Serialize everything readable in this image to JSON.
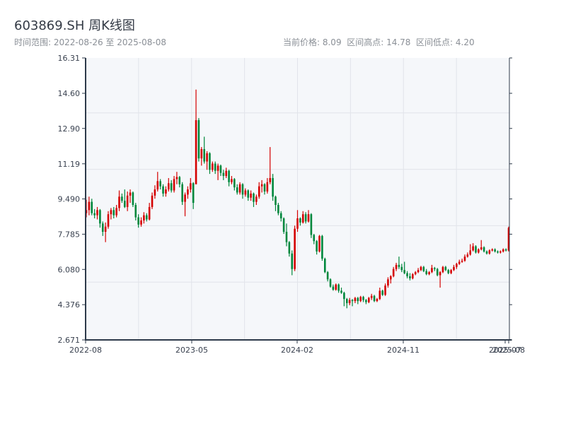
{
  "header": {
    "title": "603869.SH 周K线图",
    "range_text": "时间范围: 2022-08-26 至 2025-08-08",
    "stats_text": "当前价格: 8.09  区间高点: 14.78  区间低点: 4.20"
  },
  "chart_data": {
    "type": "candlestick",
    "title": "603869.SH 周K线图",
    "start_date": "2022-08-26",
    "end_date": "2025-08-08",
    "frequency": "weekly",
    "current_price": 8.09,
    "range_high": 14.78,
    "range_low": 4.2,
    "ylim": [
      2.671,
      16.31
    ],
    "y_ticks": [
      "16.31",
      "14.60",
      "12.90",
      "11.19",
      "9.490",
      "7.785",
      "6.080",
      "4.376",
      "2.671"
    ],
    "x_ticks": [
      "2022-08",
      "2023-05",
      "2024-02",
      "2024-11",
      "2025-07",
      "2025-08"
    ],
    "grid": true,
    "colors": {
      "up": "#d40000",
      "down": "#00873c",
      "plot_bg": "#f5f7fa",
      "grid": "#e1e4ea",
      "axis": "#2d3a4a"
    },
    "ohlc_fields": [
      "open",
      "high",
      "low",
      "close"
    ],
    "ohlc": [
      [
        8.8,
        9.45,
        8.6,
        8.95
      ],
      [
        8.95,
        9.6,
        8.7,
        9.35
      ],
      [
        9.35,
        9.5,
        8.7,
        8.8
      ],
      [
        8.8,
        9.0,
        8.55,
        8.7
      ],
      [
        8.7,
        9.1,
        8.5,
        8.95
      ],
      [
        8.95,
        9.0,
        8.1,
        8.3
      ],
      [
        8.3,
        8.4,
        7.7,
        7.9
      ],
      [
        7.9,
        8.35,
        7.4,
        8.15
      ],
      [
        8.15,
        8.9,
        8.05,
        8.75
      ],
      [
        8.75,
        9.05,
        8.5,
        8.95
      ],
      [
        8.95,
        9.1,
        8.55,
        8.7
      ],
      [
        8.7,
        9.2,
        8.6,
        9.05
      ],
      [
        9.05,
        9.9,
        8.9,
        9.6
      ],
      [
        9.6,
        9.75,
        9.3,
        9.4
      ],
      [
        9.4,
        9.95,
        9.05,
        9.1
      ],
      [
        9.1,
        9.85,
        8.9,
        9.65
      ],
      [
        9.65,
        9.95,
        9.3,
        9.8
      ],
      [
        9.8,
        9.85,
        9.1,
        9.2
      ],
      [
        9.2,
        9.3,
        8.45,
        8.6
      ],
      [
        8.6,
        8.75,
        8.1,
        8.25
      ],
      [
        8.25,
        8.6,
        8.15,
        8.45
      ],
      [
        8.45,
        8.85,
        8.3,
        8.7
      ],
      [
        8.7,
        8.8,
        8.4,
        8.5
      ],
      [
        8.5,
        9.3,
        8.45,
        9.1
      ],
      [
        9.1,
        9.8,
        9.0,
        9.65
      ],
      [
        9.65,
        10.15,
        9.5,
        9.95
      ],
      [
        9.95,
        10.8,
        9.85,
        10.35
      ],
      [
        10.35,
        10.45,
        9.95,
        10.1
      ],
      [
        10.1,
        10.2,
        9.6,
        9.75
      ],
      [
        9.75,
        10.1,
        9.6,
        9.95
      ],
      [
        9.95,
        10.5,
        9.85,
        10.25
      ],
      [
        10.25,
        10.4,
        9.8,
        9.9
      ],
      [
        9.9,
        10.6,
        9.8,
        10.45
      ],
      [
        10.45,
        10.8,
        10.2,
        10.55
      ],
      [
        10.55,
        10.6,
        10.05,
        10.2
      ],
      [
        10.2,
        10.3,
        9.2,
        9.35
      ],
      [
        9.35,
        9.8,
        8.65,
        9.7
      ],
      [
        9.7,
        10.1,
        9.5,
        9.95
      ],
      [
        9.95,
        10.5,
        9.8,
        10.25
      ],
      [
        10.25,
        10.3,
        9.0,
        9.3
      ],
      [
        10.2,
        14.78,
        10.2,
        13.3
      ],
      [
        13.3,
        13.4,
        11.3,
        11.45
      ],
      [
        11.45,
        12.0,
        11.1,
        11.9
      ],
      [
        11.9,
        12.5,
        11.2,
        11.3
      ],
      [
        11.3,
        11.8,
        10.9,
        11.7
      ],
      [
        11.7,
        11.75,
        10.7,
        10.9
      ],
      [
        10.9,
        11.3,
        10.8,
        11.2
      ],
      [
        11.2,
        11.3,
        10.7,
        10.85
      ],
      [
        10.85,
        11.2,
        10.4,
        11.1
      ],
      [
        11.1,
        11.15,
        10.6,
        10.75
      ],
      [
        10.75,
        10.9,
        10.4,
        10.6
      ],
      [
        10.6,
        11.0,
        10.5,
        10.85
      ],
      [
        10.85,
        10.9,
        10.1,
        10.3
      ],
      [
        10.3,
        10.6,
        10.2,
        10.45
      ],
      [
        10.45,
        10.5,
        9.9,
        10.05
      ],
      [
        10.05,
        10.2,
        9.7,
        9.8
      ],
      [
        9.8,
        10.3,
        9.7,
        10.2
      ],
      [
        10.2,
        10.25,
        9.5,
        9.7
      ],
      [
        9.7,
        10.0,
        9.6,
        9.9
      ],
      [
        9.9,
        9.95,
        9.4,
        9.55
      ],
      [
        9.55,
        9.9,
        9.4,
        9.75
      ],
      [
        9.75,
        9.8,
        9.1,
        9.35
      ],
      [
        9.35,
        9.7,
        9.2,
        9.6
      ],
      [
        9.6,
        10.3,
        9.5,
        10.1
      ],
      [
        10.1,
        10.4,
        9.8,
        10.2
      ],
      [
        10.2,
        10.25,
        9.7,
        9.85
      ],
      [
        9.85,
        10.5,
        9.75,
        10.3
      ],
      [
        10.3,
        12.0,
        10.2,
        10.5
      ],
      [
        10.5,
        10.7,
        9.4,
        9.6
      ],
      [
        9.6,
        9.65,
        8.9,
        9.2
      ],
      [
        9.2,
        9.3,
        8.7,
        8.8
      ],
      [
        8.8,
        8.9,
        8.4,
        8.55
      ],
      [
        8.55,
        8.6,
        7.8,
        7.9
      ],
      [
        7.9,
        8.3,
        7.2,
        7.4
      ],
      [
        7.4,
        7.45,
        6.7,
        6.85
      ],
      [
        6.85,
        7.0,
        5.8,
        6.1
      ],
      [
        6.1,
        8.2,
        6.0,
        8.05
      ],
      [
        8.05,
        8.95,
        7.9,
        8.55
      ],
      [
        8.55,
        8.6,
        8.2,
        8.35
      ],
      [
        8.35,
        8.9,
        8.3,
        8.75
      ],
      [
        8.75,
        8.85,
        8.3,
        8.4
      ],
      [
        8.4,
        8.95,
        8.35,
        8.75
      ],
      [
        8.75,
        8.8,
        7.6,
        7.75
      ],
      [
        7.75,
        7.8,
        7.3,
        7.45
      ],
      [
        7.45,
        7.5,
        6.8,
        6.95
      ],
      [
        6.95,
        7.75,
        6.9,
        7.7
      ],
      [
        7.7,
        7.75,
        6.5,
        6.6
      ],
      [
        6.6,
        6.65,
        5.9,
        5.95
      ],
      [
        5.95,
        6.0,
        5.5,
        5.6
      ],
      [
        5.6,
        5.65,
        5.2,
        5.25
      ],
      [
        5.25,
        5.35,
        5.05,
        5.1
      ],
      [
        5.1,
        5.4,
        5.05,
        5.35
      ],
      [
        5.35,
        5.4,
        4.95,
        5.05
      ],
      [
        5.05,
        5.2,
        4.9,
        4.95
      ],
      [
        4.95,
        5.0,
        4.3,
        4.65
      ],
      [
        4.65,
        4.7,
        4.2,
        4.45
      ],
      [
        4.45,
        4.7,
        4.35,
        4.6
      ],
      [
        4.6,
        4.65,
        4.3,
        4.55
      ],
      [
        4.55,
        4.75,
        4.45,
        4.7
      ],
      [
        4.7,
        4.75,
        4.4,
        4.55
      ],
      [
        4.55,
        4.8,
        4.5,
        4.75
      ],
      [
        4.75,
        4.8,
        4.5,
        4.6
      ],
      [
        4.6,
        4.65,
        4.4,
        4.5
      ],
      [
        4.5,
        4.75,
        4.45,
        4.7
      ],
      [
        4.7,
        4.9,
        4.6,
        4.8
      ],
      [
        4.8,
        4.85,
        4.5,
        4.55
      ],
      [
        4.55,
        4.7,
        4.5,
        4.65
      ],
      [
        4.65,
        5.2,
        4.6,
        5.05
      ],
      [
        5.05,
        5.1,
        4.8,
        4.85
      ],
      [
        4.85,
        5.4,
        4.8,
        5.3
      ],
      [
        5.3,
        5.7,
        5.2,
        5.6
      ],
      [
        5.6,
        5.8,
        5.4,
        5.75
      ],
      [
        5.75,
        6.2,
        5.7,
        6.1
      ],
      [
        6.1,
        6.4,
        6.0,
        6.3
      ],
      [
        6.3,
        6.7,
        6.1,
        6.2
      ],
      [
        6.2,
        6.35,
        5.95,
        6.05
      ],
      [
        6.05,
        6.45,
        5.85,
        5.9
      ],
      [
        5.9,
        6.0,
        5.65,
        5.75
      ],
      [
        5.75,
        5.9,
        5.55,
        5.65
      ],
      [
        5.65,
        5.9,
        5.6,
        5.85
      ],
      [
        5.85,
        6.0,
        5.8,
        5.95
      ],
      [
        5.95,
        6.15,
        5.9,
        6.05
      ],
      [
        6.05,
        6.25,
        6.0,
        6.2
      ],
      [
        6.2,
        6.25,
        5.95,
        6.0
      ],
      [
        6.0,
        6.1,
        5.8,
        5.85
      ],
      [
        5.85,
        6.0,
        5.8,
        5.95
      ],
      [
        5.95,
        6.3,
        5.9,
        6.15
      ],
      [
        6.15,
        6.2,
        6.0,
        6.1
      ],
      [
        6.1,
        6.15,
        5.75,
        5.8
      ],
      [
        5.8,
        6.0,
        5.2,
        5.95
      ],
      [
        5.95,
        6.25,
        5.9,
        6.2
      ],
      [
        6.2,
        6.25,
        6.0,
        6.05
      ],
      [
        6.05,
        6.1,
        5.85,
        5.9
      ],
      [
        5.9,
        6.1,
        5.85,
        6.05
      ],
      [
        6.05,
        6.3,
        6.0,
        6.2
      ],
      [
        6.2,
        6.4,
        6.1,
        6.35
      ],
      [
        6.35,
        6.55,
        6.3,
        6.45
      ],
      [
        6.45,
        6.6,
        6.4,
        6.5
      ],
      [
        6.5,
        6.8,
        6.45,
        6.7
      ],
      [
        6.7,
        6.9,
        6.65,
        6.8
      ],
      [
        6.8,
        7.3,
        6.75,
        7.0
      ],
      [
        7.0,
        7.35,
        6.95,
        7.2
      ],
      [
        7.2,
        7.25,
        6.85,
        6.9
      ],
      [
        6.9,
        7.1,
        6.85,
        7.05
      ],
      [
        7.05,
        7.5,
        7.0,
        7.15
      ],
      [
        7.15,
        7.2,
        6.9,
        6.95
      ],
      [
        6.95,
        7.0,
        6.8,
        6.85
      ],
      [
        6.85,
        7.05,
        6.8,
        7.0
      ],
      [
        7.0,
        7.1,
        6.95,
        7.05
      ],
      [
        7.05,
        7.1,
        6.9,
        6.95
      ],
      [
        6.95,
        7.0,
        6.85,
        6.9
      ],
      [
        6.9,
        7.0,
        6.85,
        6.95
      ],
      [
        6.95,
        7.1,
        6.9,
        7.05
      ],
      [
        7.05,
        7.1,
        6.95,
        7.0
      ],
      [
        7.0,
        8.15,
        6.95,
        8.09
      ]
    ]
  }
}
